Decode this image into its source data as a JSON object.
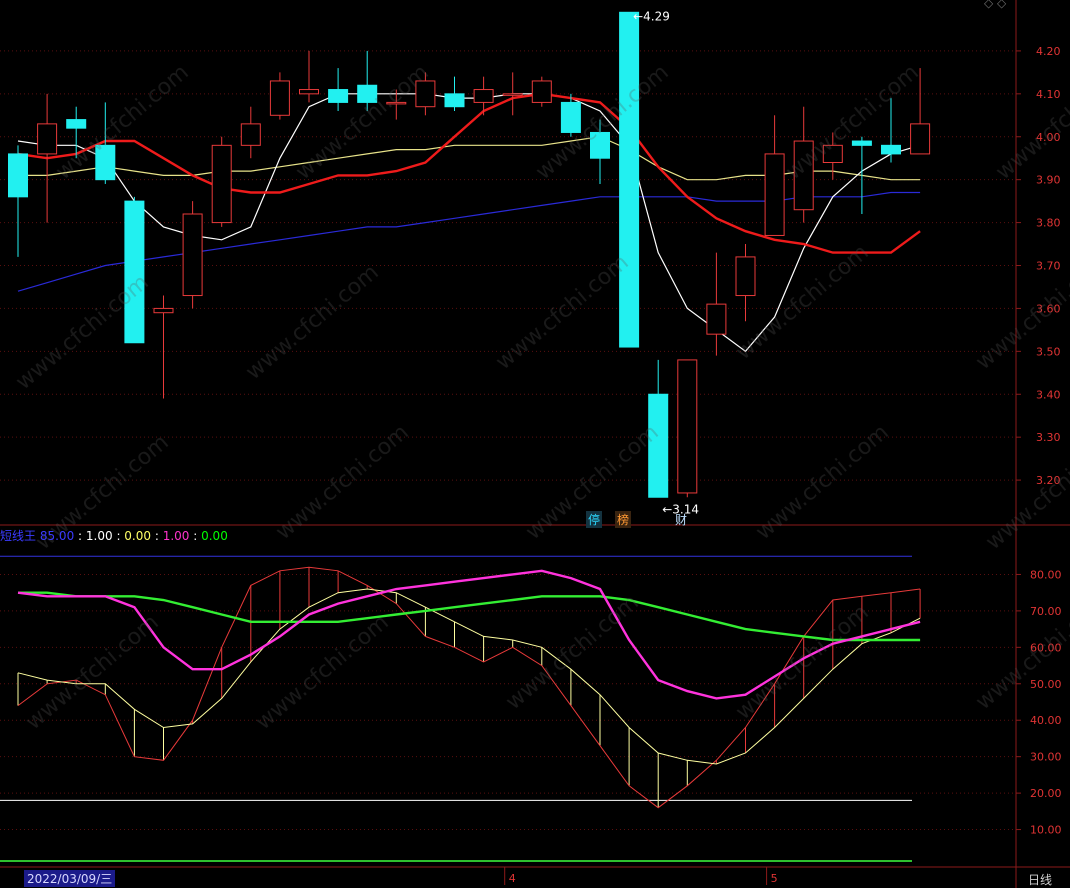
{
  "colors": {
    "up": "#e83a3a",
    "down": "#22f0f0",
    "ma5": "#ffffff",
    "ma10": "#ee1b1b",
    "ma20": "#e8e38a",
    "ma60": "#2a2ad8",
    "axis": "#8c1a1a",
    "ind_k": "#e83a3a",
    "ind_d": "#ffffa0",
    "ind_j": "#ff33dd",
    "ind_m": "#33ee33",
    "ind_upper": "#3333dd",
    "ind_lower": "#ffffff"
  },
  "chart_data": {
    "type": "candlestick",
    "price_ticks": [
      "4.20",
      "4.10",
      "4.00",
      "3.90",
      "3.80",
      "3.70",
      "3.60",
      "3.50",
      "3.40",
      "3.30",
      "3.20"
    ],
    "price_range": [
      3.1,
      4.3
    ],
    "max_label": "4.29",
    "min_label": "3.14",
    "candles": [
      {
        "o": 3.96,
        "c": 3.86,
        "h": 3.98,
        "l": 3.72
      },
      {
        "o": 3.96,
        "c": 4.03,
        "h": 4.1,
        "l": 3.8
      },
      {
        "o": 4.04,
        "c": 4.02,
        "h": 4.07,
        "l": 3.95
      },
      {
        "o": 3.98,
        "c": 3.9,
        "h": 4.08,
        "l": 3.89
      },
      {
        "o": 3.85,
        "c": 3.52,
        "h": 3.86,
        "l": 3.52
      },
      {
        "o": 3.59,
        "c": 3.6,
        "h": 3.63,
        "l": 3.39
      },
      {
        "o": 3.63,
        "c": 3.82,
        "h": 3.85,
        "l": 3.6
      },
      {
        "o": 3.8,
        "c": 3.98,
        "h": 4.0,
        "l": 3.79
      },
      {
        "o": 3.98,
        "c": 4.03,
        "h": 4.07,
        "l": 3.95
      },
      {
        "o": 4.05,
        "c": 4.13,
        "h": 4.15,
        "l": 4.04
      },
      {
        "o": 4.1,
        "c": 4.11,
        "h": 4.2,
        "l": 4.08
      },
      {
        "o": 4.11,
        "c": 4.08,
        "h": 4.16,
        "l": 4.06
      },
      {
        "o": 4.12,
        "c": 4.08,
        "h": 4.2,
        "l": 4.06
      },
      {
        "o": 4.08,
        "c": 4.08,
        "h": 4.11,
        "l": 4.04
      },
      {
        "o": 4.07,
        "c": 4.13,
        "h": 4.15,
        "l": 4.05
      },
      {
        "o": 4.1,
        "c": 4.07,
        "h": 4.14,
        "l": 4.06
      },
      {
        "o": 4.08,
        "c": 4.11,
        "h": 4.14,
        "l": 4.05
      },
      {
        "o": 4.1,
        "c": 4.1,
        "h": 4.15,
        "l": 4.05
      },
      {
        "o": 4.08,
        "c": 4.13,
        "h": 4.14,
        "l": 4.07
      },
      {
        "o": 4.08,
        "c": 4.01,
        "h": 4.1,
        "l": 4.0
      },
      {
        "o": 4.01,
        "c": 3.95,
        "h": 4.04,
        "l": 3.89
      },
      {
        "o": 4.29,
        "c": 3.51,
        "h": 4.29,
        "l": 3.51
      },
      {
        "o": 3.4,
        "c": 3.16,
        "h": 3.48,
        "l": 3.16
      },
      {
        "o": 3.17,
        "c": 3.48,
        "h": 3.48,
        "l": 3.16
      },
      {
        "o": 3.54,
        "c": 3.61,
        "h": 3.73,
        "l": 3.49
      },
      {
        "o": 3.63,
        "c": 3.72,
        "h": 3.75,
        "l": 3.57
      },
      {
        "o": 3.77,
        "c": 3.96,
        "h": 4.05,
        "l": 3.77
      },
      {
        "o": 3.83,
        "c": 3.99,
        "h": 4.07,
        "l": 3.8
      },
      {
        "o": 3.94,
        "c": 3.98,
        "h": 4.01,
        "l": 3.9
      },
      {
        "o": 3.99,
        "c": 3.98,
        "h": 4.0,
        "l": 3.82
      },
      {
        "o": 3.98,
        "c": 3.96,
        "h": 4.09,
        "l": 3.94
      },
      {
        "o": 3.96,
        "c": 4.03,
        "h": 4.16,
        "l": 3.96
      }
    ],
    "ma5": [
      3.99,
      3.98,
      3.98,
      3.95,
      3.85,
      3.79,
      3.77,
      3.76,
      3.79,
      3.95,
      4.07,
      4.1,
      4.1,
      4.1,
      4.1,
      4.09,
      4.09,
      4.1,
      4.1,
      4.09,
      4.06,
      3.98,
      3.73,
      3.6,
      3.55,
      3.5,
      3.58,
      3.74,
      3.86,
      3.92,
      3.96,
      3.98
    ],
    "ma10": [
      3.96,
      3.95,
      3.96,
      3.99,
      3.99,
      3.95,
      3.91,
      3.88,
      3.87,
      3.87,
      3.89,
      3.91,
      3.91,
      3.92,
      3.94,
      4.0,
      4.06,
      4.09,
      4.1,
      4.09,
      4.08,
      4.02,
      3.93,
      3.86,
      3.81,
      3.78,
      3.76,
      3.75,
      3.73,
      3.73,
      3.73,
      3.78
    ],
    "ma20": [
      3.91,
      3.91,
      3.92,
      3.93,
      3.92,
      3.91,
      3.91,
      3.92,
      3.92,
      3.93,
      3.94,
      3.95,
      3.96,
      3.97,
      3.97,
      3.98,
      3.98,
      3.98,
      3.98,
      3.99,
      4.0,
      3.97,
      3.93,
      3.9,
      3.9,
      3.91,
      3.91,
      3.92,
      3.92,
      3.91,
      3.9,
      3.9
    ],
    "ma60": [
      3.64,
      3.66,
      3.68,
      3.7,
      3.71,
      3.72,
      3.73,
      3.74,
      3.75,
      3.76,
      3.77,
      3.78,
      3.79,
      3.79,
      3.8,
      3.81,
      3.82,
      3.83,
      3.84,
      3.85,
      3.86,
      3.86,
      3.86,
      3.86,
      3.85,
      3.85,
      3.85,
      3.86,
      3.86,
      3.86,
      3.87,
      3.87
    ],
    "indicator": {
      "name": "短线王",
      "values_text": [
        "85.00",
        "1.00",
        "0.00",
        "1.00",
        "0.00"
      ],
      "ticks": [
        "80.00",
        "70.00",
        "60.00",
        "50.00",
        "40.00",
        "30.00",
        "20.00",
        "10.00"
      ],
      "range": [
        0,
        90
      ],
      "upper_level": 85,
      "lower_level": 18,
      "k": [
        44,
        50,
        51,
        47,
        30,
        29,
        40,
        60,
        77,
        81,
        82,
        81,
        77,
        72,
        63,
        60,
        56,
        60,
        55,
        44,
        33,
        22,
        16,
        22,
        29,
        38,
        50,
        63,
        73,
        74,
        75,
        76
      ],
      "d": [
        53,
        51,
        50,
        50,
        43,
        38,
        39,
        46,
        56,
        65,
        71,
        75,
        76,
        75,
        71,
        67,
        63,
        62,
        60,
        54,
        47,
        38,
        31,
        29,
        28,
        31,
        38,
        46,
        54,
        61,
        64,
        68
      ],
      "j": [
        75,
        74,
        74,
        74,
        71,
        60,
        54,
        54,
        58,
        63,
        69,
        72,
        74,
        76,
        77,
        78,
        79,
        80,
        81,
        79,
        76,
        62,
        51,
        48,
        46,
        47,
        52,
        57,
        61,
        63,
        65,
        67
      ],
      "m": [
        75,
        75,
        74,
        74,
        74,
        73,
        71,
        69,
        67,
        67,
        67,
        67,
        68,
        69,
        70,
        71,
        72,
        73,
        74,
        74,
        74,
        73,
        71,
        69,
        67,
        65,
        64,
        63,
        62,
        62,
        62,
        62
      ]
    },
    "x_labels": [
      "4",
      "5"
    ],
    "date_label": "2022/03/09/三",
    "period_label": "日线",
    "events": [
      "停",
      "榜",
      "财"
    ],
    "watermark": "www.cfchi.com"
  }
}
